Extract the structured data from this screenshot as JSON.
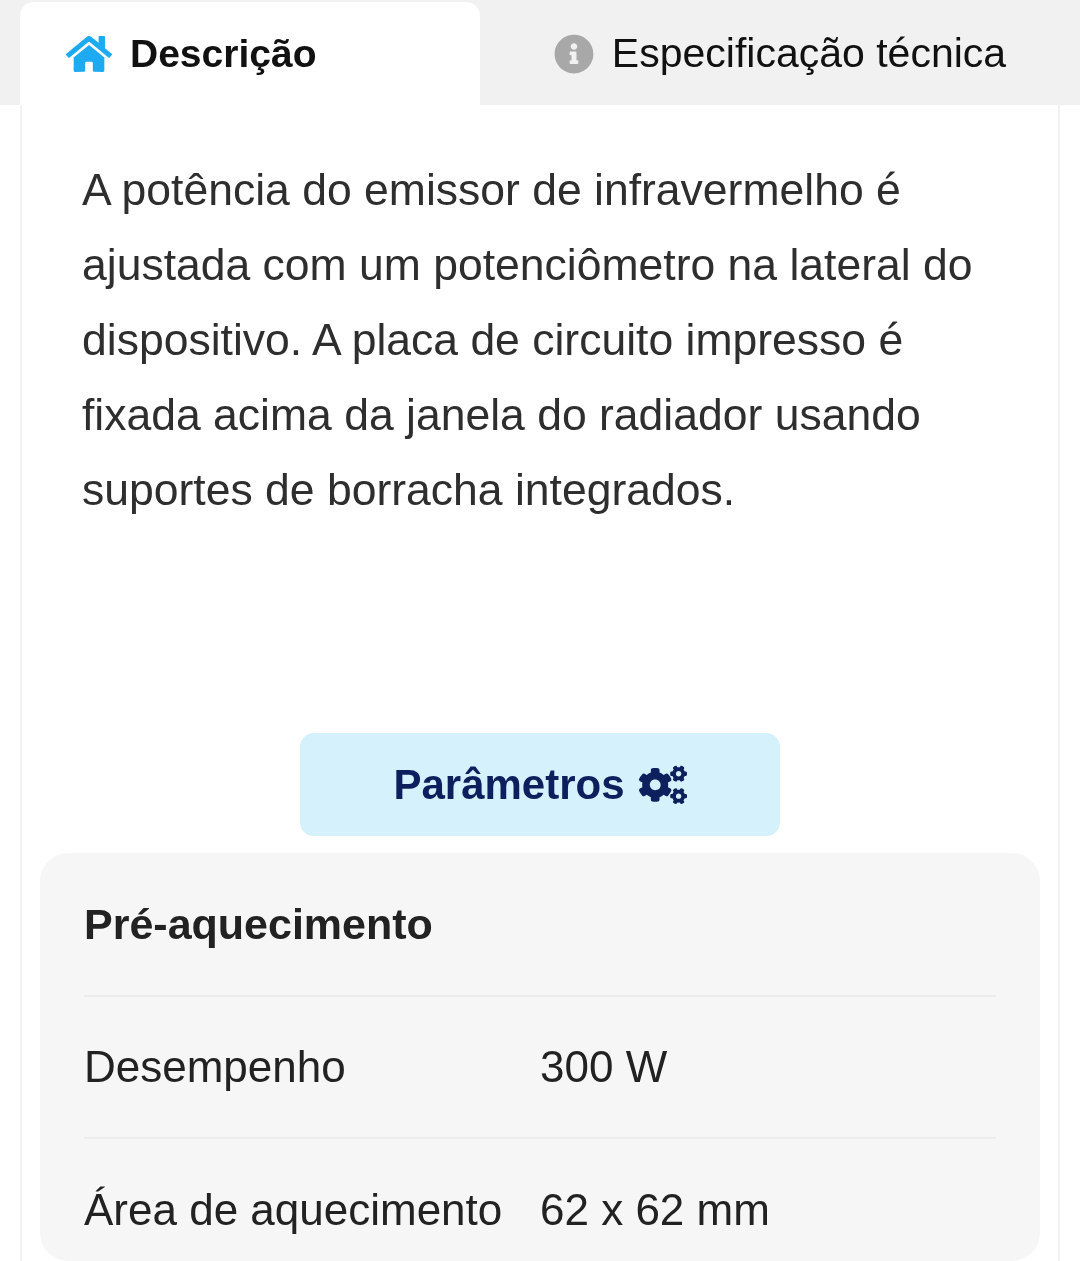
{
  "tabs": [
    {
      "label": "Descrição",
      "selected": true
    },
    {
      "label": "Especificação técnica",
      "selected": false
    }
  ],
  "description": "A potência do emissor de infravermelho é ajustada com um potenciômetro na lateral do dispositivo. A placa de circuito impresso é fixada acima da janela do radiador usando suportes de borracha integrados.",
  "parameters_button": {
    "label": "Parâmetros"
  },
  "spec_table": {
    "group": "Pré-aquecimento",
    "rows": [
      {
        "name": "Desempenho",
        "value": "300 W"
      },
      {
        "name": "Área de aquecimento",
        "value": "62 x 62 mm"
      }
    ]
  }
}
